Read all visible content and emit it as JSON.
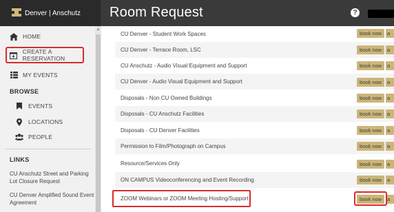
{
  "header": {
    "brand": "Denver | Anschutz",
    "title": "Room Request",
    "help": "?"
  },
  "sidebar": {
    "home": "HOME",
    "create": "CREATE A RESERVATION",
    "my_events": "MY EVENTS",
    "browse": "BROWSE",
    "events": "EVENTS",
    "locations": "LOCATIONS",
    "people": "PEOPLE",
    "links": "LINKS",
    "link_items": [
      "CU Anschutz Street and Parking Lot Closure Request",
      "CU Denver Amplified Sound Event Agreement"
    ]
  },
  "list": {
    "book_label": "book now",
    "book_extra": "a",
    "rows": [
      "CU Denver - Student Work Spaces",
      "CU Denver - Terrace Room, LSC",
      "CU Anschutz - Audio Visual Equipment and Support",
      "CU Denver - Audio Visual Equipment and Support",
      "Disposals - Non CU Owned Buildings",
      "Disposals - CU Anschutz Facilities",
      "Disposals - CU Denver Facilities",
      "Permission to Film/Photograph on Campus",
      "Resource/Services Only",
      "ON CAMPUS Videoconferencing and Event Recording",
      "ZOOM Webinars or ZOOM Meeting Hosting/Support"
    ]
  },
  "colors": {
    "topbar": "#3a3a3a",
    "book_button": "#cbb67a",
    "highlight": "#d92b2b"
  }
}
